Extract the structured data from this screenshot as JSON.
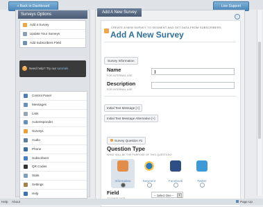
{
  "topbar": {
    "back_label": "« Back to Dashboard",
    "live_support_label": "Live Support"
  },
  "sidebar": {
    "header": "Surveys Options",
    "links": [
      {
        "label": "Add a Survey",
        "icon": "add-icon"
      },
      {
        "label": "Update Your Surveys",
        "icon": "edit-icon"
      },
      {
        "label": "Add Subscribers Field",
        "icon": "field-icon"
      }
    ],
    "help": {
      "text": "Need help? Try our",
      "link": "tutorials"
    },
    "menu": [
      {
        "label": "Control Panel",
        "icon": "control-panel-icon",
        "color": "#4f7fb3"
      },
      {
        "label": "Messages",
        "icon": "messages-icon",
        "color": "#6b8fbf"
      },
      {
        "label": "Lists",
        "icon": "lists-icon",
        "color": "#9aa6b2"
      },
      {
        "label": "Autoresponder",
        "icon": "autoresponder-icon",
        "color": "#6b8fbf"
      },
      {
        "label": "Surveys",
        "icon": "surveys-icon",
        "color": "#e7a23b"
      },
      {
        "label": "Audio",
        "icon": "audio-icon",
        "color": "#5a7ea6"
      },
      {
        "label": "Phone",
        "icon": "phone-icon",
        "color": "#3c6ea3"
      },
      {
        "label": "Subscribers",
        "icon": "subscribers-icon",
        "color": "#4a7fb8"
      },
      {
        "label": "QR Codes",
        "icon": "qr-codes-icon",
        "color": "#333333"
      },
      {
        "label": "Stats",
        "icon": "stats-icon",
        "color": "#7f9fc2"
      },
      {
        "label": "Settings",
        "icon": "settings-icon",
        "color": "#a77f4f"
      },
      {
        "label": "Help",
        "icon": "help-icon",
        "color": "#3c72b0"
      }
    ]
  },
  "main": {
    "header": "Add A New Survey",
    "subtitle": "CREATE A NEW SURVEY TO SEGMENT AND GET DATA FROM SUBSCRIBERS.",
    "title": "Add A New Survey",
    "survey_info_label": "Survey Information",
    "name_label": "Name",
    "name_sub": "FOR INTERNAL USE",
    "name_value": "",
    "description_label": "Description",
    "description_sub": "FOR INTERNAL USE",
    "description_value": "",
    "initial_text_label": "Initial Text Message",
    "initial_alt_label": "Initial Text Message Alternative",
    "toggle_label": "[+]",
    "question_tag": "Survey Question #1",
    "question_type_title": "Question Type",
    "question_type_sub": "WHAT WILL BE THE PURPOSE OF THIS QUESTION?",
    "question_types": [
      {
        "label": "Information",
        "icon": "person-icon",
        "selected": true
      },
      {
        "label": "Segment",
        "icon": "pie-chart-icon",
        "selected": false
      },
      {
        "label": "Facebook",
        "icon": "facebook-icon",
        "selected": false
      },
      {
        "label": "Twitter",
        "icon": "twitter-icon",
        "selected": false
      }
    ],
    "field_label": "Field",
    "field_sub": "TO SAVE DATA",
    "field_select": "-- Select One --"
  },
  "footer": {
    "help": "Help",
    "about": "About",
    "page_up": "Page Up"
  },
  "colors": {
    "accent": "#2f6f9b",
    "header_bg": "#56677f",
    "button_blue": "#4a86b8"
  }
}
